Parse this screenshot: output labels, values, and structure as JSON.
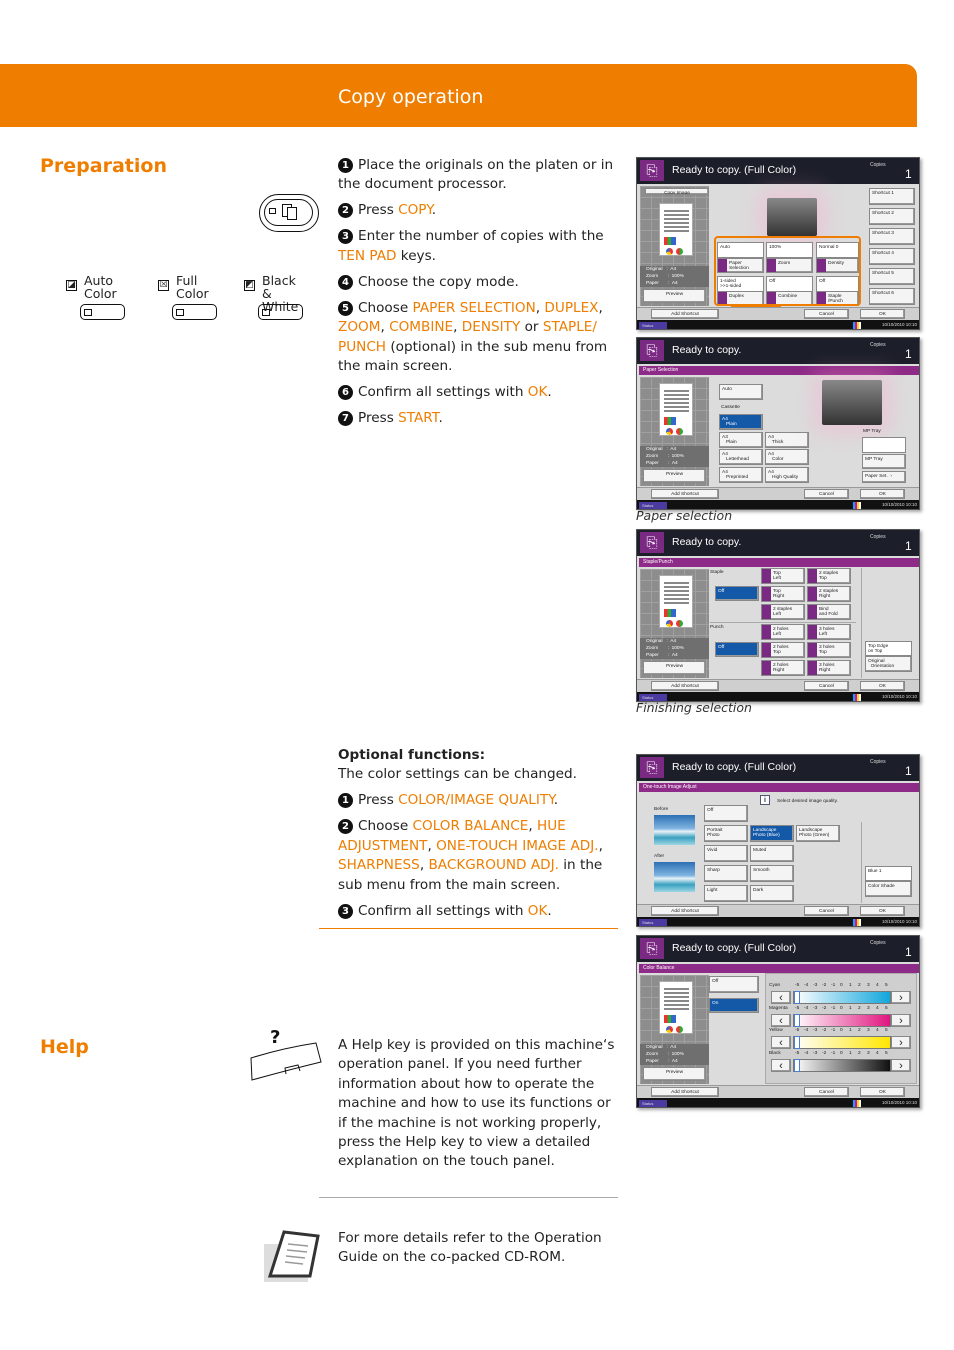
{
  "header": {
    "title": "Copy operation"
  },
  "colors": {
    "accent": "#EE7D00",
    "panel_purple": "#7B2A84",
    "selected_blue": "#1458A8"
  },
  "preparation": {
    "heading": "Preparation",
    "copy_key_icon": "copy-key-icon",
    "modes": [
      {
        "label": "Auto Color",
        "icon": "auto-color-icon"
      },
      {
        "label": "Full Color",
        "icon": "full-color-icon"
      },
      {
        "label": "Black & White",
        "icon": "black-white-icon"
      }
    ],
    "steps": [
      [
        {
          "t": "Place the originals on the platen or in the document processor."
        }
      ],
      [
        {
          "t": "Press "
        },
        {
          "t": "COPY",
          "hl": true
        },
        {
          "t": "."
        }
      ],
      [
        {
          "t": "Enter the number of copies with the "
        },
        {
          "t": "TEN PAD",
          "hl": true
        },
        {
          "t": " keys."
        }
      ],
      [
        {
          "t": "Choose the copy mode."
        }
      ],
      [
        {
          "t": "Choose "
        },
        {
          "t": "PAPER SELECTION",
          "hl": true
        },
        {
          "t": ", "
        },
        {
          "t": "DUPLEX",
          "hl": true
        },
        {
          "t": ", "
        },
        {
          "t": "ZOOM",
          "hl": true
        },
        {
          "t": ", "
        },
        {
          "t": "COMBINE",
          "hl": true
        },
        {
          "t": ", "
        },
        {
          "t": "DENSITY",
          "hl": true
        },
        {
          "t": " or "
        },
        {
          "t": "STAPLE/ PUNCH",
          "hl": true
        },
        {
          "t": " (optional) in the sub menu from the main screen."
        }
      ],
      [
        {
          "t": "Confirm all settings with "
        },
        {
          "t": "OK",
          "hl": true
        },
        {
          "t": "."
        }
      ],
      [
        {
          "t": "Press "
        },
        {
          "t": "START",
          "hl": true
        },
        {
          "t": "."
        }
      ]
    ]
  },
  "optional": {
    "heading": "Optional functions:",
    "intro": "The color settings can be changed.",
    "steps": [
      [
        {
          "t": "Press "
        },
        {
          "t": "COLOR/IMAGE QUALITY",
          "hl": true
        },
        {
          "t": "."
        }
      ],
      [
        {
          "t": "Choose "
        },
        {
          "t": "COLOR BALANCE",
          "hl": true
        },
        {
          "t": ", "
        },
        {
          "t": "HUE ADJUSTMENT",
          "hl": true
        },
        {
          "t": ", "
        },
        {
          "t": "ONE-TOUCH IMAGE ADJ.",
          "hl": true
        },
        {
          "t": ", "
        },
        {
          "t": "SHARPNESS",
          "hl": true
        },
        {
          "t": ", "
        },
        {
          "t": "BACKGROUND ADJ.",
          "hl": true
        },
        {
          "t": " in the sub menu from the main screen."
        }
      ],
      [
        {
          "t": "Confirm all settings with "
        },
        {
          "t": "OK",
          "hl": true
        },
        {
          "t": "."
        }
      ]
    ]
  },
  "help": {
    "heading": "Help",
    "icon": "help-key-icon",
    "text": "A Help key is provided on this machine‘s operation panel. If you need further information about how to operate the machine and how to use its functions or if the machine is not working properly, press the Help key to view a detailed explanation on the touch panel."
  },
  "more": {
    "icon": "manual-book-icon",
    "text": "For more details refer to the Operation Guide on the co-packed CD-ROM."
  },
  "captions": {
    "paper": "Paper selection",
    "finishing": "Finishing selection"
  },
  "panel_common": {
    "copies_label": "Copies",
    "copies": "1",
    "status": "Status",
    "datetime": "10/10/2010 10:10",
    "original": "Original   :  A4",
    "zoom": "Zoom       :  100%",
    "paper": "Paper       :  A4",
    "preview": "Preview",
    "add_shortcut": "Add Shortcut",
    "cancel": "Cancel",
    "ok": "OK"
  },
  "panels": [
    {
      "title": "Ready to copy. (Full Color)",
      "copy_image": "Copy Image",
      "values": [
        "Auto",
        "100%",
        "Normal 0",
        "1-sided\n>>1-sided",
        "Off",
        "Off"
      ],
      "functions": [
        "Paper\nSelection",
        "Zoom",
        "Density",
        "Duplex",
        "Combine",
        "Staple\n/Punch"
      ],
      "shortcuts": [
        "Shortcut 1",
        "Shortcut 2",
        "Shortcut 3",
        "Shortcut 4",
        "Shortcut 5",
        "Shortcut 6"
      ],
      "tabs": [
        "Quick Setup",
        "Org./Paper\nFinishing",
        "Color/\nImage Quality",
        "Layout/Edit",
        "Advanced\nSetup",
        "Program"
      ]
    },
    {
      "title": "Ready to copy.",
      "sub": "Paper Selection",
      "cassette": "Cassette",
      "mp_tray_label": "MP Tray",
      "buttons": [
        "Auto",
        "A4\n   Plain",
        "A3\n   Plain",
        "A4\n   Thick",
        "A4\n   Letterhead",
        "A4\n   Color",
        "A4\n   Preprinted",
        "A4\n   High Quality",
        "MP Tray",
        "Paper Set.  ›"
      ]
    },
    {
      "title": "Ready to copy.",
      "sub": "Staple/Punch",
      "staple": "Staple",
      "punch": "Punch",
      "off": "Off",
      "staple_opts": [
        "Top\nLeft",
        "2 staples\nTop",
        "Top\nRight",
        "2 staples\nRight",
        "2 staples\nLeft",
        "Bind\nand Fold"
      ],
      "punch_opts": [
        "2 holes\nLeft",
        "3 holes\nLeft",
        "2 holes\nTop",
        "3 holes\nTop",
        "2 holes\nRight",
        "3 holes\nRight"
      ],
      "orientation_value": "Top Edge\non Top",
      "orientation": "Original\n  Orientation"
    },
    {
      "title": "Ready to copy. (Full Color)",
      "sub": "One-touch Image Adjust",
      "before": "Before",
      "after": "After",
      "hint": "Select desired image quality.",
      "options": [
        "Off",
        "Portrait\nPhoto",
        "Landscape\nPhoto (Blue)",
        "Landscape\nPhoto (Green)",
        "Vivid",
        "Muted",
        "Sharp",
        "Smooth",
        "Light",
        "Dark"
      ],
      "selected": "Landscape\nPhoto (Blue)",
      "shade_value": "Blue 1",
      "shade": "Color Shade"
    },
    {
      "title": "Ready to copy. (Full Color)",
      "sub": "Color Balance",
      "off": "Off",
      "on": "On",
      "ticks": [
        "-5",
        "-4",
        "-3",
        "-2",
        "-1",
        "0",
        "1",
        "2",
        "3",
        "4",
        "5"
      ],
      "channels": [
        {
          "name": "Cyan",
          "value": -5,
          "color": "#12a6dc"
        },
        {
          "name": "Magenta",
          "value": -5,
          "color": "#e0157f"
        },
        {
          "name": "Yellow",
          "value": -5,
          "color": "#ffe600"
        },
        {
          "name": "Black",
          "value": -5,
          "color": "#111111"
        }
      ]
    }
  ]
}
